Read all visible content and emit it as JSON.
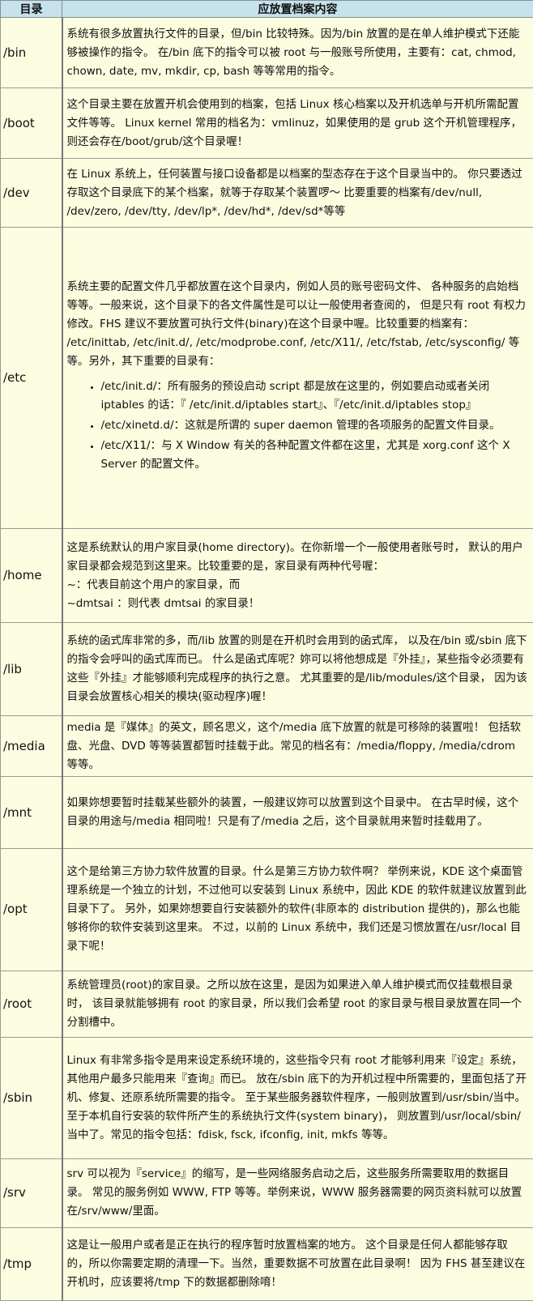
{
  "headers": {
    "dir": "目录",
    "content": "应放置档案内容"
  },
  "rows": [
    {
      "dir": "/bin",
      "p": [
        "系统有很多放置执行文件的目录，但/bin 比较特殊。因为/bin 放置的是在单人维护模式下还能够被操作的指令。 在/bin 底下的指令可以被 root 与一般账号所使用，主要有：cat, chmod, chown, date, mv, mkdir, cp, bash 等等常用的指令。"
      ]
    },
    {
      "dir": "/boot",
      "p": [
        "这个目录主要在放置开机会使用到的档案，包括 Linux 核心档案以及开机选单与开机所需配置文件等等。 Linux kernel 常用的档名为：vmlinuz，如果使用的是 grub 这个开机管理程序， 则还会存在/boot/grub/这个目录喔！"
      ]
    },
    {
      "dir": "/dev",
      "p": [
        "在 Linux 系统上，任何装置与接口设备都是以档案的型态存在于这个目录当中的。 你只要透过存取这个目录底下的某个档案，就等于存取某个装置啰～ 比要重要的档案有/dev/null, /dev/zero, /dev/tty, /dev/lp*, /dev/hd*, /dev/sd*等等"
      ]
    },
    {
      "dir": "/etc",
      "p": [
        "系统主要的配置文件几乎都放置在这个目录内，例如人员的账号密码文件、 各种服务的启始档等等。一般来说，这个目录下的各文件属性是可以让一般使用者查阅的， 但是只有 root 有权力修改。FHS 建议不要放置可执行文件(binary)在这个目录中喔。比较重要的档案有： /etc/inittab, /etc/init.d/, /etc/modprobe.conf, /etc/X11/, /etc/fstab, /etc/sysconfig/ 等等。另外，其下重要的目录有："
      ],
      "items": [
        "/etc/init.d/：所有服务的预设启动 script 都是放在这里的，例如要启动或者关闭 iptables 的话：『 /etc/init.d/iptables start』、『/etc/init.d/iptables stop』",
        "/etc/xinetd.d/：这就是所谓的 super daemon 管理的各项服务的配置文件目录。",
        "/etc/X11/：与 X Window 有关的各种配置文件都在这里，尤其是 xorg.conf 这个 X Server 的配置文件。"
      ]
    },
    {
      "dir": "/home",
      "p": [
        "这是系统默认的用户家目录(home directory)。在你新增一个一般使用者账号时， 默认的用户家目录都会规范到这里来。比较重要的是，家目录有两种代号喔：<br>~：代表目前这个用户的家目录，而<br>~dmtsai ：则代表 dmtsai 的家目录！"
      ]
    },
    {
      "dir": "/lib",
      "p": [
        "系统的函式库非常的多，而/lib 放置的则是在开机时会用到的函式库， 以及在/bin 或/sbin 底下的指令会呼叫的函式库而已。 什么是函式库呢？妳可以将他想成是『外挂』，某些指令必须要有这些『外挂』才能够顺利完成程序的执行之意。 尤其重要的是/lib/modules/这个目录， 因为该目录会放置核心相关的模块(驱动程序)喔！"
      ]
    },
    {
      "dir": "/media",
      "p": [
        "media 是『媒体』的英文，顾名思义，这个/media 底下放置的就是可移除的装置啦！ 包括软盘、光盘、DVD 等等装置都暂时挂载于此。常见的档名有：/media/floppy, /media/cdrom 等等。"
      ]
    },
    {
      "dir": "/mnt",
      "p": [
        "如果妳想要暂时挂载某些额外的装置，一般建议妳可以放置到这个目录中。 在古早时候，这个目录的用途与/media 相同啦！只是有了/media 之后，这个目录就用来暂时挂载用了。"
      ]
    },
    {
      "dir": "/opt",
      "p": [
        "这个是给第三方协力软件放置的目录。什么是第三方协力软件啊？ 举例来说，KDE 这个桌面管理系统是一个独立的计划，不过他可以安装到 Linux 系统中，因此 KDE 的软件就建议放置到此目录下了。 另外，如果妳想要自行安装额外的软件(非原本的 distribution 提供的)，那么也能够将你的软件安装到这里来。 不过，以前的 Linux 系统中，我们还是习惯放置在/usr/local 目录下呢！"
      ]
    },
    {
      "dir": "/root",
      "p": [
        "系统管理员(root)的家目录。之所以放在这里，是因为如果进入单人维护模式而仅挂载根目录时， 该目录就能够拥有 root 的家目录，所以我们会希望 root 的家目录与根目录放置在同一个分割槽中。"
      ]
    },
    {
      "dir": "/sbin",
      "p": [
        "Linux 有非常多指令是用来设定系统环境的，这些指令只有 root 才能够利用来『设定』系统，其他用户最多只能用来『查询』而已。 放在/sbin 底下的为开机过程中所需要的，里面包括了开机、修复、还原系统所需要的指令。 至于某些服务器软件程序，一般则放置到/usr/sbin/当中。至于本机自行安装的软件所产生的系统执行文件(system binary)， 则放置到/usr/local/sbin/当中了。常见的指令包括：fdisk, fsck, ifconfig, init, mkfs 等等。"
      ]
    },
    {
      "dir": "/srv",
      "p": [
        "srv 可以视为『service』的缩写，是一些网络服务启动之后，这些服务所需要取用的数据目录。 常见的服务例如 WWW, FTP 等等。举例来说，WWW 服务器需要的网页资料就可以放置在/srv/www/里面。"
      ]
    },
    {
      "dir": "/tmp",
      "p": [
        "这是让一般用户或者是正在执行的程序暂时放置档案的地方。 这个目录是任何人都能够存取的，所以你需要定期的清理一下。当然，重要数据不可放置在此目录啊！ 因为 FHS 甚至建议在开机时，应该要将/tmp 下的数据都删除唷！"
      ]
    }
  ]
}
